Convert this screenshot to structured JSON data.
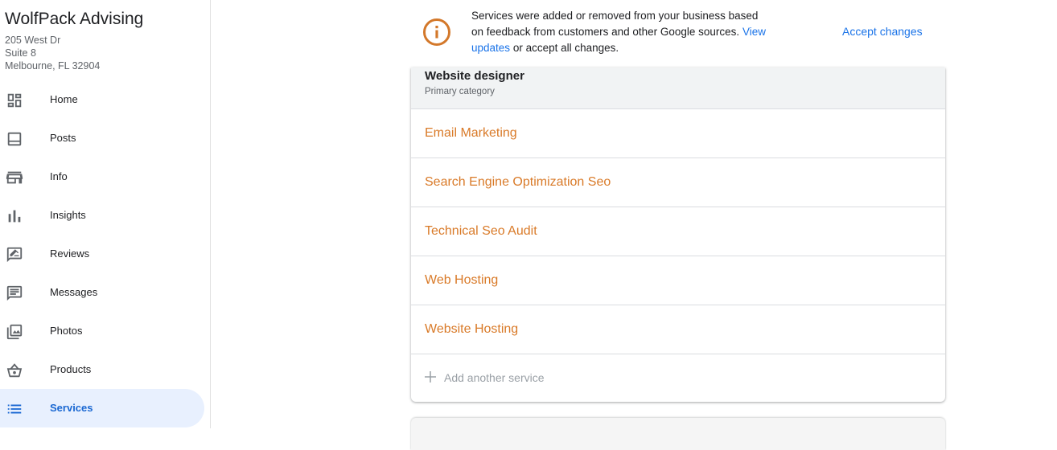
{
  "business": {
    "name": "WolfPack Advising",
    "address": [
      "205 West Dr",
      "Suite 8",
      "Melbourne, FL 32904"
    ]
  },
  "nav": {
    "items": [
      {
        "label": "Home",
        "icon": "dashboard-icon"
      },
      {
        "label": "Posts",
        "icon": "posts-icon"
      },
      {
        "label": "Info",
        "icon": "storefront-icon"
      },
      {
        "label": "Insights",
        "icon": "bar-chart-icon"
      },
      {
        "label": "Reviews",
        "icon": "rate-review-icon"
      },
      {
        "label": "Messages",
        "icon": "message-icon"
      },
      {
        "label": "Photos",
        "icon": "photo-library-icon"
      },
      {
        "label": "Products",
        "icon": "shopping-basket-icon"
      },
      {
        "label": "Services",
        "icon": "list-icon"
      }
    ],
    "active": "Services"
  },
  "banner": {
    "message_pre": "Services were added or removed from your business based on feedback from customers and other Google sources.",
    "link_text": "View updates",
    "message_post": "or accept all changes.",
    "accept_label": "Accept changes"
  },
  "services_card": {
    "category": "Website designer",
    "category_sub": "Primary category",
    "services": [
      "Email Marketing",
      "Search Engine Optimization Seo",
      "Technical Seo Audit",
      "Web Hosting",
      "Website Hosting"
    ],
    "add_label": "Add another service"
  },
  "colors": {
    "accent_blue": "#1a73e8",
    "active_nav_bg": "#e8f0fe",
    "service_orange": "#d97a28",
    "info_orange": "#d3782a"
  }
}
